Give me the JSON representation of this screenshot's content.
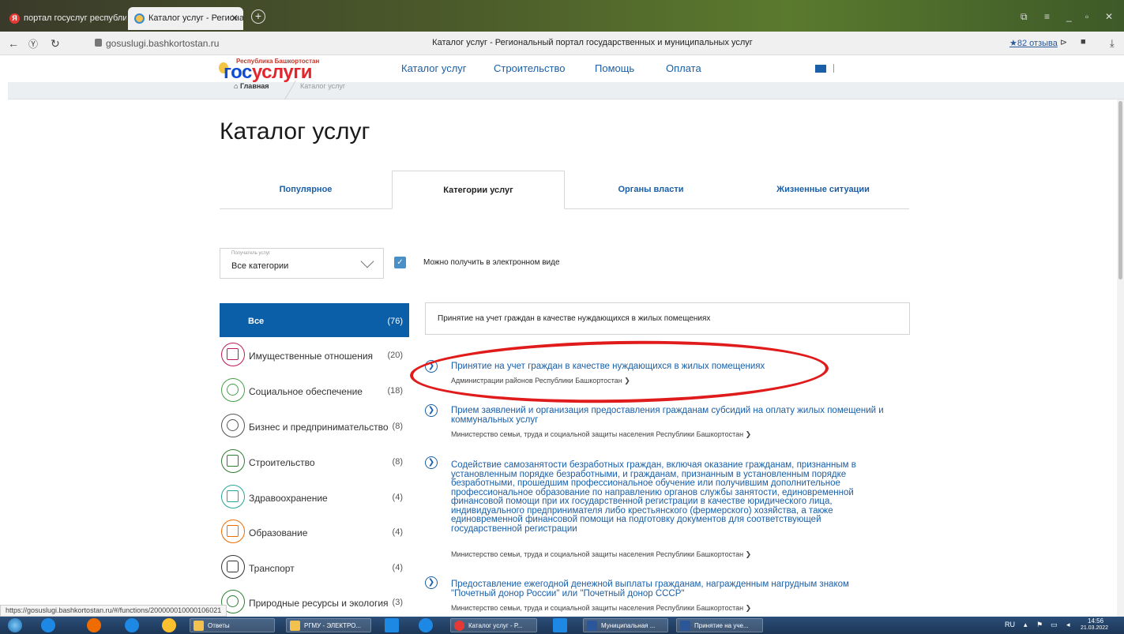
{
  "browser": {
    "tabs": [
      {
        "label": "портал госуслуг республи",
        "icon": "yandex-icon"
      },
      {
        "label": "Каталог услуг - Региона",
        "icon": "gosuslugi-icon"
      }
    ],
    "url": "gosuslugi.bashkortostan.ru",
    "page_title": "Каталог услуг - Региональный портал государственных и муниципальных услуг",
    "reviews": "★82 отзыва",
    "status_url": "https://gosuslugi.bashkortostan.ru/#/functions/200000010000106021"
  },
  "site": {
    "logo_sup": "Республика Башкортостан",
    "logo_main_a": "гос",
    "logo_main_b": "услуги",
    "nav": [
      "Каталог услуг",
      "Строительство",
      "Помощь",
      "Оплата"
    ],
    "breadcrumb": {
      "home": "Главная",
      "current": "Каталог услуг"
    }
  },
  "main": {
    "heading": "Каталог услуг",
    "tabs": [
      "Популярное",
      "Категории услуг",
      "Органы власти",
      "Жизненные ситуации"
    ],
    "active_tab": 1,
    "filter": {
      "label": "Получатель услуг",
      "value": "Все категории",
      "checkbox_label": "Можно получить в электронном виде",
      "checked": true
    },
    "categories": [
      {
        "label": "Все",
        "count": "(76)"
      },
      {
        "label": "Имущественные отношения",
        "count": "(20)"
      },
      {
        "label": "Социальное обеспечение",
        "count": "(18)"
      },
      {
        "label": "Бизнес и предпринимательство",
        "count": "(8)"
      },
      {
        "label": "Строительство",
        "count": "(8)"
      },
      {
        "label": "Здравоохранение",
        "count": "(4)"
      },
      {
        "label": "Образование",
        "count": "(4)"
      },
      {
        "label": "Транспорт",
        "count": "(4)"
      },
      {
        "label": "Природные ресурсы и экология",
        "count": "(3)"
      }
    ],
    "search_text": "Принятие на учет граждан в качестве нуждающихся в жилых помещениях",
    "services": [
      {
        "title": "Принятие на учет граждан в качестве нуждающихся в жилых помещениях",
        "org": "Администрации районов Республики Башкортостан ❯"
      },
      {
        "title": "Прием заявлений и организация предоставления гражданам субсидий на оплату жилых помещений и коммунальных услуг",
        "org": "Министерство семьи, труда и социальной защиты населения Республики Башкортостан ❯"
      },
      {
        "title": "Содействие самозанятости безработных граждан, включая оказание гражданам, признанным в установленным порядке безработными, и гражданам, признанным в установленным порядке безработными, прошедшим профессиональное обучение или получившим дополнительное профессиональное образование по направлению органов службы занятости, единовременной финансовой помощи при их государственной регистрации в качестве юридического лица, индивидуального предпринимателя либо крестьянского (фермерского) хозяйства, а также единовременной финансовой помощи на подготовку документов для соответствующей государственной регистрации",
        "org": "Министерство семьи, труда и социальной защиты населения Республики Башкортостан ❯"
      },
      {
        "title": "Предоставление ежегодной денежной выплаты гражданам, награжденным нагрудным знаком \"Почетный донор России\" или \"Почетный донор СССР\"",
        "org": "Министерство семьи, труда и социальной защиты населения Республики Башкортостан ❯"
      }
    ]
  },
  "taskbar": {
    "items": [
      "Ответы",
      "РГМУ - ЭЛЕКТРО...",
      "Каталог услуг - Р...",
      "Муниципальная ...",
      "Принятие на уче..."
    ],
    "lang": "RU",
    "time": "14:56",
    "date": "21.03.2022"
  },
  "colors": {
    "accent": "#0b5ea8",
    "link": "#1a5fa8",
    "highlight": "#e01b1b"
  }
}
